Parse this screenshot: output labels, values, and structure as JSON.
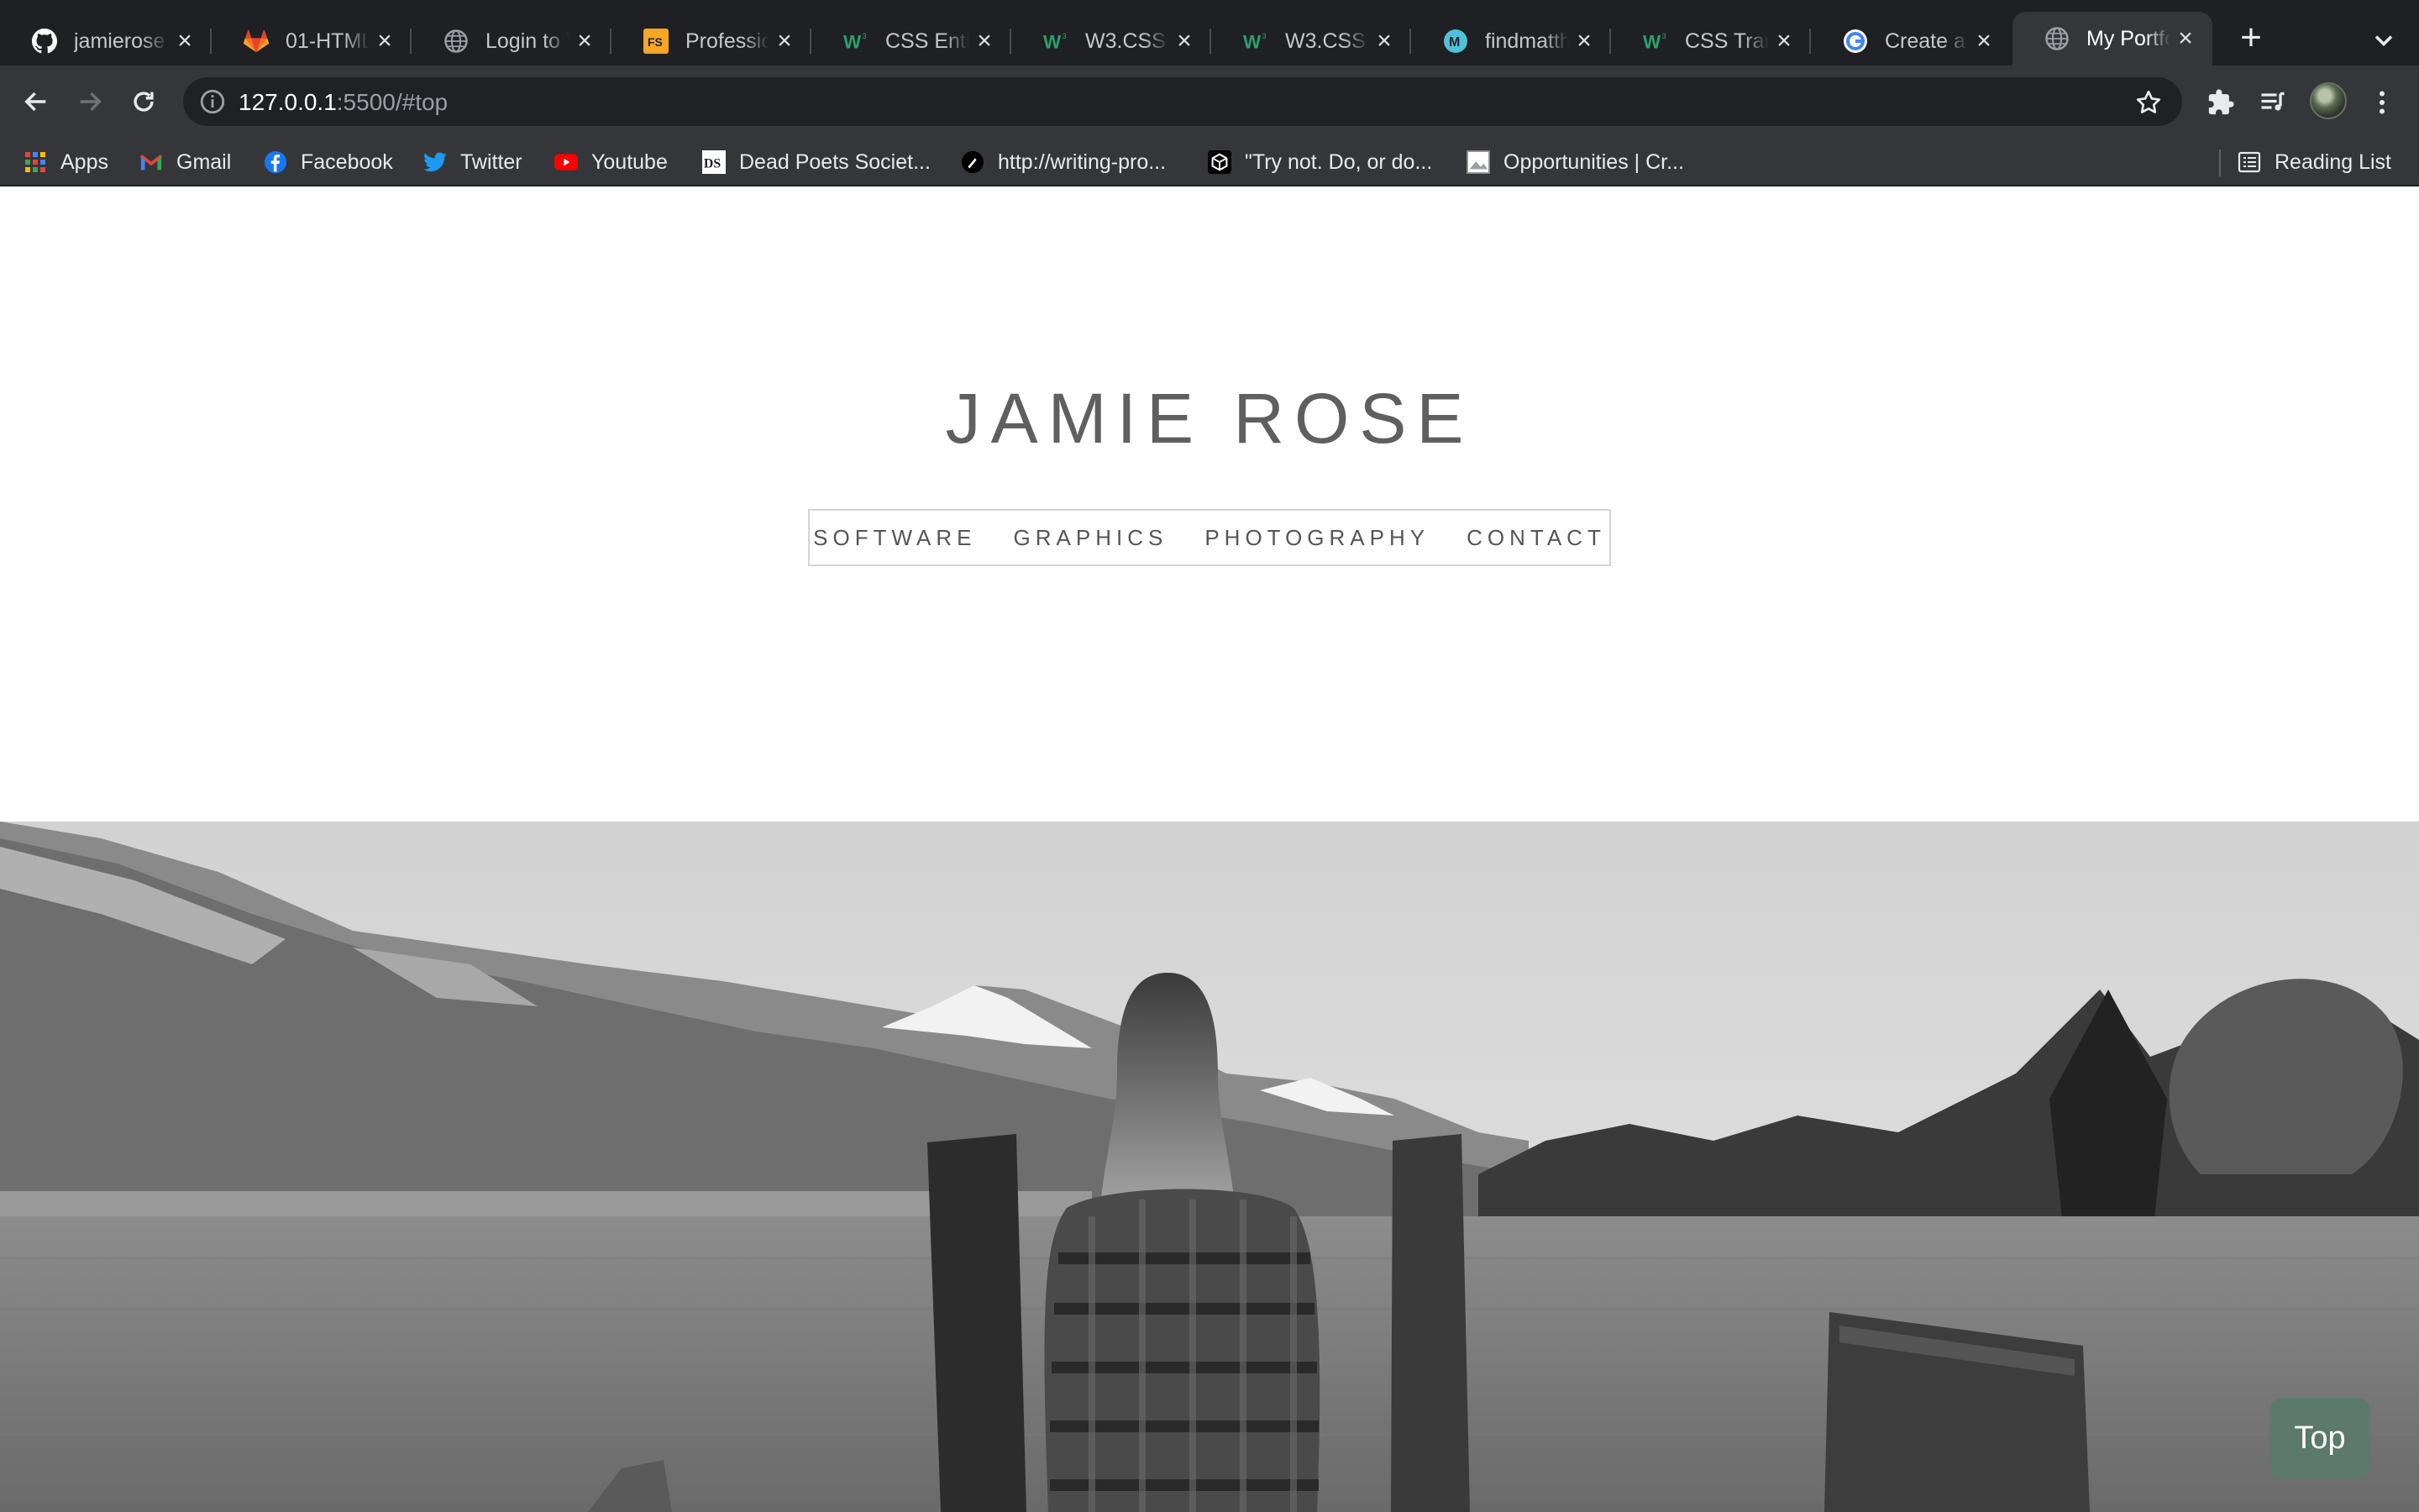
{
  "browser": {
    "tabs": [
      {
        "title": "jamierose",
        "icon": "github-icon",
        "active": false
      },
      {
        "title": "01-HTML",
        "icon": "gitlab-icon",
        "active": false
      },
      {
        "title": "Login to Y",
        "icon": "globe-icon",
        "active": false
      },
      {
        "title": "Professio",
        "icon": "fs-icon",
        "active": false
      },
      {
        "title": "CSS Entit",
        "icon": "w3schools-icon",
        "active": false
      },
      {
        "title": "W3.CSS T",
        "icon": "w3schools-icon",
        "active": false
      },
      {
        "title": "W3.CSS T",
        "icon": "w3schools-icon",
        "active": false
      },
      {
        "title": "findmatth",
        "icon": "m-icon",
        "active": false
      },
      {
        "title": "CSS Tran",
        "icon": "w3schools-icon",
        "active": false
      },
      {
        "title": "Create a p",
        "icon": "google-icon",
        "active": false
      },
      {
        "title": "My Portfo",
        "icon": "globe-icon",
        "active": true
      }
    ],
    "url": {
      "host": "127.0.0.1",
      "rest": ":5500/#top"
    },
    "bookmarks": [
      {
        "label": "Apps",
        "icon": "apps-grid-icon"
      },
      {
        "label": "Gmail",
        "icon": "gmail-icon"
      },
      {
        "label": "Facebook",
        "icon": "facebook-icon"
      },
      {
        "label": "Twitter",
        "icon": "twitter-icon"
      },
      {
        "label": "Youtube",
        "icon": "youtube-icon"
      },
      {
        "label": "Dead Poets Societ...",
        "icon": "ds-icon"
      },
      {
        "label": "http://writing-pro...",
        "icon": "pen-icon"
      },
      {
        "label": "\"Try not. Do, or do...",
        "icon": "codepen-icon"
      },
      {
        "label": "Opportunities | Cr...",
        "icon": "image-icon"
      }
    ],
    "reading_list": "Reading List"
  },
  "site": {
    "title": "JAMIE ROSE",
    "nav": [
      "SOFTWARE",
      "GRAPHICS",
      "PHOTOGRAPHY",
      "CONTACT"
    ],
    "top_button": "Top"
  },
  "colors": {
    "tab_strip": "#1f2023",
    "toolbar": "#35363a",
    "top_button": "#5b7a6b",
    "title_text": "#5f5f5f"
  }
}
